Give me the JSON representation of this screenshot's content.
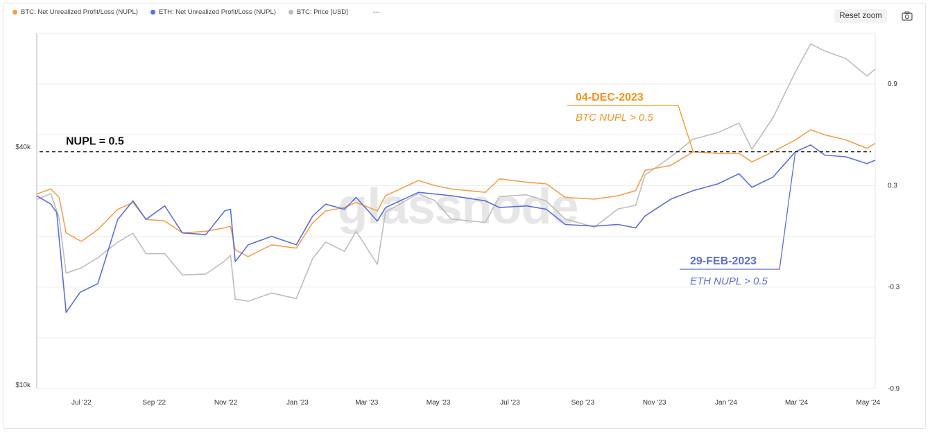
{
  "legend": [
    {
      "label": "BTC: Net Unrealized Profit/Loss (NUPL)",
      "color": "#f4a04a"
    },
    {
      "label": "ETH: Net Unrealized Profit/Loss (NUPL)",
      "color": "#5b6ee1"
    },
    {
      "label": "BTC: Price [USD]",
      "color": "#bdbdbd"
    },
    {
      "label": "---",
      "color": ""
    }
  ],
  "toolbar": {
    "reset_label": "Reset zoom"
  },
  "watermark": "glassnode",
  "chart_data": {
    "type": "line",
    "x_range": [
      "2022-05-24",
      "2024-05-07"
    ],
    "x_ticks": [
      "Jul '22",
      "Sep '22",
      "Nov '22",
      "Jan '23",
      "Mar '23",
      "May '23",
      "Jul '23",
      "Sep '23",
      "Nov '23",
      "Jan '24",
      "Mar '24",
      "May '24"
    ],
    "left_axis": {
      "label": "",
      "scale": "log",
      "ticks": [
        "$40k",
        "$10k"
      ]
    },
    "right_axis": {
      "label": "",
      "range": [
        -0.9,
        1.2
      ],
      "ticks": [
        "0.9",
        "0.3",
        "-0.3",
        "-0.9"
      ]
    },
    "reference_line": {
      "y": 0.5,
      "label": "NUPL = 0.5",
      "style": "dashed"
    },
    "annotations": [
      {
        "date_label": "04-DEC-2023",
        "text": "BTC NUPL > 0.5",
        "color": "#f7931a",
        "point_date": "2023-12-04",
        "point_value": 0.5
      },
      {
        "date_label": "29-FEB-2023",
        "text": "ETH NUPL > 0.5",
        "color": "#5b6ee1",
        "point_date": "2024-02-29",
        "point_value": 0.5
      }
    ],
    "series": [
      {
        "name": "BTC: Net Unrealized Profit/Loss (NUPL)",
        "axis": "right",
        "color": "#f4a04a",
        "points": [
          [
            "2022-05-24",
            0.25
          ],
          [
            "2022-06-05",
            0.28
          ],
          [
            "2022-06-12",
            0.23
          ],
          [
            "2022-06-18",
            0.02
          ],
          [
            "2022-07-01",
            -0.03
          ],
          [
            "2022-07-15",
            0.04
          ],
          [
            "2022-08-01",
            0.16
          ],
          [
            "2022-08-14",
            0.2
          ],
          [
            "2022-08-25",
            0.1
          ],
          [
            "2022-09-10",
            0.09
          ],
          [
            "2022-09-25",
            0.02
          ],
          [
            "2022-10-15",
            0.03
          ],
          [
            "2022-10-31",
            0.05
          ],
          [
            "2022-11-05",
            0.06
          ],
          [
            "2022-11-09",
            -0.08
          ],
          [
            "2022-11-20",
            -0.12
          ],
          [
            "2022-12-10",
            -0.05
          ],
          [
            "2022-12-31",
            -0.07
          ],
          [
            "2023-01-14",
            0.08
          ],
          [
            "2023-01-25",
            0.15
          ],
          [
            "2023-02-10",
            0.17
          ],
          [
            "2023-02-20",
            0.2
          ],
          [
            "2023-03-10",
            0.15
          ],
          [
            "2023-03-17",
            0.24
          ],
          [
            "2023-04-14",
            0.33
          ],
          [
            "2023-04-28",
            0.3
          ],
          [
            "2023-05-12",
            0.28
          ],
          [
            "2023-06-10",
            0.26
          ],
          [
            "2023-06-22",
            0.34
          ],
          [
            "2023-07-15",
            0.32
          ],
          [
            "2023-08-01",
            0.31
          ],
          [
            "2023-08-17",
            0.23
          ],
          [
            "2023-09-11",
            0.22
          ],
          [
            "2023-10-01",
            0.24
          ],
          [
            "2023-10-16",
            0.27
          ],
          [
            "2023-10-24",
            0.39
          ],
          [
            "2023-11-15",
            0.42
          ],
          [
            "2023-12-04",
            0.5
          ],
          [
            "2023-12-25",
            0.49
          ],
          [
            "2024-01-12",
            0.49
          ],
          [
            "2024-01-23",
            0.44
          ],
          [
            "2024-02-10",
            0.5
          ],
          [
            "2024-02-29",
            0.57
          ],
          [
            "2024-03-13",
            0.63
          ],
          [
            "2024-03-25",
            0.6
          ],
          [
            "2024-04-12",
            0.57
          ],
          [
            "2024-04-30",
            0.52
          ],
          [
            "2024-05-07",
            0.55
          ]
        ]
      },
      {
        "name": "ETH: Net Unrealized Profit/Loss (NUPL)",
        "axis": "right",
        "color": "#5b6ee1",
        "points": [
          [
            "2022-05-24",
            0.24
          ],
          [
            "2022-06-05",
            0.19
          ],
          [
            "2022-06-10",
            0.14
          ],
          [
            "2022-06-18",
            -0.45
          ],
          [
            "2022-06-30",
            -0.33
          ],
          [
            "2022-07-15",
            -0.28
          ],
          [
            "2022-08-01",
            0.1
          ],
          [
            "2022-08-14",
            0.21
          ],
          [
            "2022-08-25",
            0.1
          ],
          [
            "2022-09-10",
            0.18
          ],
          [
            "2022-09-25",
            0.02
          ],
          [
            "2022-10-15",
            0.01
          ],
          [
            "2022-10-31",
            0.15
          ],
          [
            "2022-11-05",
            0.16
          ],
          [
            "2022-11-09",
            -0.15
          ],
          [
            "2022-11-20",
            -0.05
          ],
          [
            "2022-12-10",
            0.0
          ],
          [
            "2022-12-31",
            -0.05
          ],
          [
            "2023-01-14",
            0.12
          ],
          [
            "2023-01-25",
            0.19
          ],
          [
            "2023-02-10",
            0.16
          ],
          [
            "2023-02-20",
            0.23
          ],
          [
            "2023-03-10",
            0.09
          ],
          [
            "2023-03-17",
            0.17
          ],
          [
            "2023-04-14",
            0.26
          ],
          [
            "2023-04-28",
            0.25
          ],
          [
            "2023-05-12",
            0.24
          ],
          [
            "2023-06-10",
            0.21
          ],
          [
            "2023-06-22",
            0.17
          ],
          [
            "2023-07-15",
            0.18
          ],
          [
            "2023-08-01",
            0.16
          ],
          [
            "2023-08-17",
            0.07
          ],
          [
            "2023-09-11",
            0.06
          ],
          [
            "2023-10-01",
            0.07
          ],
          [
            "2023-10-16",
            0.05
          ],
          [
            "2023-10-24",
            0.12
          ],
          [
            "2023-11-15",
            0.22
          ],
          [
            "2023-12-04",
            0.27
          ],
          [
            "2023-12-25",
            0.31
          ],
          [
            "2024-01-12",
            0.37
          ],
          [
            "2024-01-23",
            0.29
          ],
          [
            "2024-02-10",
            0.35
          ],
          [
            "2024-02-29",
            0.5
          ],
          [
            "2024-03-13",
            0.54
          ],
          [
            "2024-03-25",
            0.48
          ],
          [
            "2024-04-12",
            0.47
          ],
          [
            "2024-04-30",
            0.43
          ],
          [
            "2024-05-07",
            0.45
          ]
        ]
      },
      {
        "name": "BTC: Price [USD]",
        "axis": "left",
        "color": "#bdbdbd",
        "points": [
          [
            "2022-05-24",
            29500
          ],
          [
            "2022-06-05",
            30500
          ],
          [
            "2022-06-12",
            26500
          ],
          [
            "2022-06-18",
            19200
          ],
          [
            "2022-07-01",
            19800
          ],
          [
            "2022-07-15",
            21000
          ],
          [
            "2022-08-01",
            23000
          ],
          [
            "2022-08-14",
            24200
          ],
          [
            "2022-08-25",
            21500
          ],
          [
            "2022-09-10",
            21500
          ],
          [
            "2022-09-25",
            19000
          ],
          [
            "2022-10-15",
            19100
          ],
          [
            "2022-10-31",
            20600
          ],
          [
            "2022-11-05",
            21300
          ],
          [
            "2022-11-09",
            16500
          ],
          [
            "2022-11-20",
            16300
          ],
          [
            "2022-12-10",
            17100
          ],
          [
            "2022-12-31",
            16550
          ],
          [
            "2023-01-14",
            20900
          ],
          [
            "2023-01-25",
            23000
          ],
          [
            "2023-02-10",
            21800
          ],
          [
            "2023-02-20",
            24500
          ],
          [
            "2023-03-10",
            20200
          ],
          [
            "2023-03-17",
            27400
          ],
          [
            "2023-04-14",
            30500
          ],
          [
            "2023-04-28",
            29300
          ],
          [
            "2023-05-12",
            26300
          ],
          [
            "2023-06-10",
            25800
          ],
          [
            "2023-06-22",
            30000
          ],
          [
            "2023-07-15",
            30300
          ],
          [
            "2023-08-01",
            29200
          ],
          [
            "2023-08-17",
            26300
          ],
          [
            "2023-09-11",
            25100
          ],
          [
            "2023-10-01",
            27900
          ],
          [
            "2023-10-16",
            28500
          ],
          [
            "2023-10-24",
            34000
          ],
          [
            "2023-11-15",
            37800
          ],
          [
            "2023-12-04",
            41900
          ],
          [
            "2023-12-25",
            43500
          ],
          [
            "2024-01-12",
            46000
          ],
          [
            "2024-01-23",
            39500
          ],
          [
            "2024-02-10",
            47500
          ],
          [
            "2024-02-29",
            62000
          ],
          [
            "2024-03-13",
            73000
          ],
          [
            "2024-03-25",
            70000
          ],
          [
            "2024-04-12",
            67000
          ],
          [
            "2024-04-30",
            60500
          ],
          [
            "2024-05-07",
            63000
          ]
        ]
      }
    ]
  }
}
